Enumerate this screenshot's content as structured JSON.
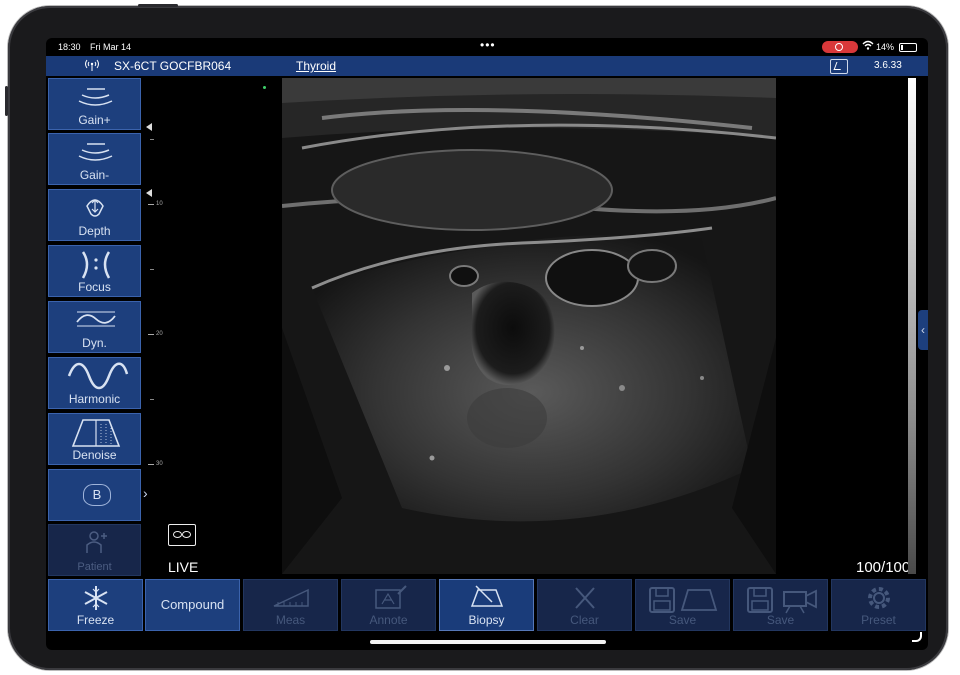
{
  "status_bar": {
    "time": "18:30",
    "date": "Fri Mar 14",
    "dots": "•••",
    "battery_pct": "14%"
  },
  "header": {
    "device_id": "SX-6CT GOCFBR064",
    "preset": "Thyroid",
    "version": "3.6.33"
  },
  "left_toolbar": {
    "items": [
      {
        "label": "Gain+",
        "icon": "gain-up-icon"
      },
      {
        "label": "Gain-",
        "icon": "gain-down-icon"
      },
      {
        "label": "Depth",
        "icon": "depth-icon"
      },
      {
        "label": "Focus",
        "icon": "focus-icon"
      },
      {
        "label": "Dyn.",
        "icon": "dynamic-range-icon"
      },
      {
        "label": "Harmonic",
        "icon": "harmonic-wave-icon"
      },
      {
        "label": "Denoise",
        "icon": "denoise-icon"
      },
      {
        "label": "B",
        "icon": "b-mode-icon"
      },
      {
        "label": "Patient",
        "icon": "patient-icon"
      }
    ]
  },
  "ruler": {
    "labels": [
      "10",
      "20",
      "30"
    ]
  },
  "image": {
    "live_label": "LIVE",
    "frame_counter": "100/100"
  },
  "bottom_toolbar": {
    "items": [
      {
        "label": "Freeze",
        "icon": "snowflake-icon",
        "enabled": true
      },
      {
        "label": "Compound",
        "icon": "",
        "enabled": true
      },
      {
        "label": "Meas",
        "icon": "ruler-icon",
        "enabled": false
      },
      {
        "label": "Annote",
        "icon": "annotate-icon",
        "enabled": false
      },
      {
        "label": "Biopsy",
        "icon": "biopsy-icon",
        "enabled": true
      },
      {
        "label": "Clear",
        "icon": "clear-x-icon",
        "enabled": false
      },
      {
        "label": "Save",
        "icon": "save-image-icon",
        "enabled": false
      },
      {
        "label": "Save",
        "icon": "save-video-icon",
        "enabled": false
      },
      {
        "label": "Preset",
        "icon": "gear-icon",
        "enabled": false
      }
    ]
  },
  "colors": {
    "toolbar_blue": "#1d3f7d",
    "header_blue": "#1a3a78",
    "record_red": "#d9383a"
  }
}
